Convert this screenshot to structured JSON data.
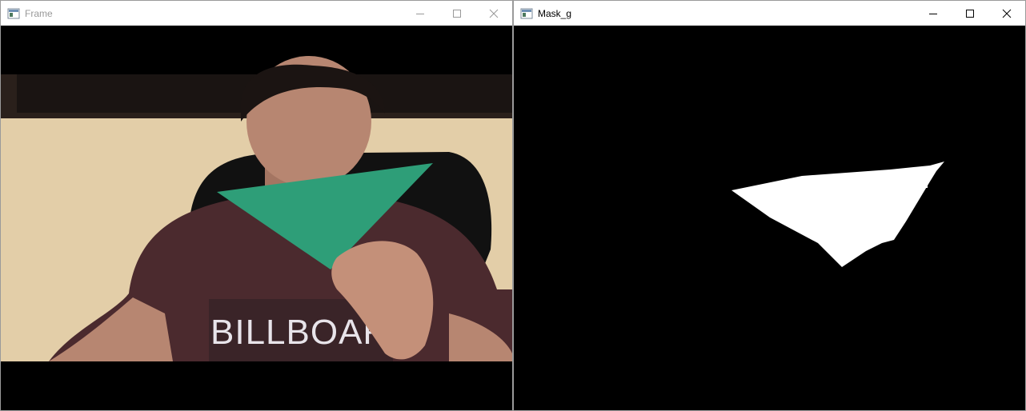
{
  "windows": [
    {
      "title": "Frame",
      "icons": [
        "app-icon",
        "minimize-icon",
        "maximize-icon",
        "close-icon"
      ],
      "title_color": "#999999"
    },
    {
      "title": "Mask_g",
      "icons": [
        "app-icon",
        "minimize-icon",
        "maximize-icon",
        "close-icon"
      ],
      "title_color": "#000000"
    }
  ],
  "frame_image": {
    "shirt_text": "BILLBOAR",
    "colors": {
      "wall": "#e3cea8",
      "shirt": "#4b2a2e",
      "paper": "#2e9e78",
      "skin": "#b78671",
      "hair": "#1b1412",
      "chair": "#111111"
    }
  },
  "mask_image": {
    "foreground": "#ffffff",
    "background": "#000000"
  }
}
